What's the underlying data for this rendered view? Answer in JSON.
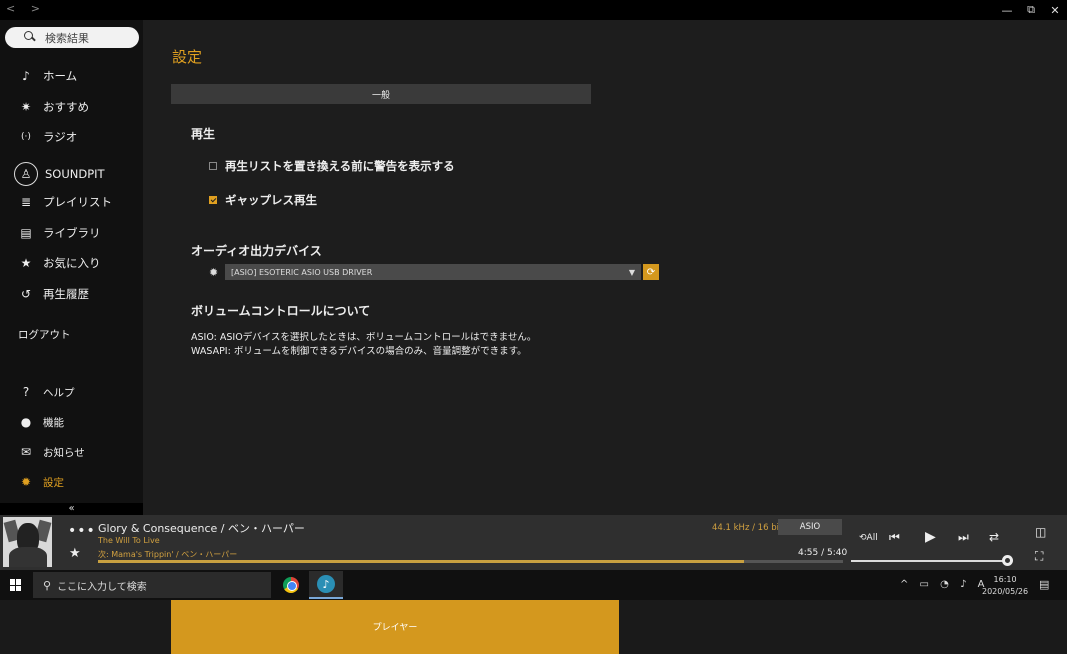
{
  "titlebar": {
    "back": "<",
    "forward": ">",
    "minimize": "—",
    "restore": "⧉",
    "close": "✕"
  },
  "sidebar": {
    "search_placeholder": "検索結果",
    "items": [
      {
        "label": "ホーム",
        "icon": "home-logo-icon",
        "glyph": "♪"
      },
      {
        "label": "おすすめ",
        "icon": "sparkle-icon",
        "glyph": "✷"
      },
      {
        "label": "ラジオ",
        "icon": "radio-icon",
        "glyph": "(·)"
      },
      {
        "label": "SOUNDPIT",
        "icon": "user-icon",
        "glyph": "♙"
      },
      {
        "label": "プレイリスト",
        "icon": "playlist-icon",
        "glyph": "≣"
      },
      {
        "label": "ライブラリ",
        "icon": "library-icon",
        "glyph": "▤"
      },
      {
        "label": "お気に入り",
        "icon": "star-icon",
        "glyph": "★"
      },
      {
        "label": "再生履歴",
        "icon": "history-icon",
        "glyph": "↺"
      }
    ],
    "logout": "ログアウト",
    "bottom_items": [
      {
        "label": "ヘルプ",
        "icon": "help-icon",
        "glyph": "?"
      },
      {
        "label": "機能",
        "icon": "new-badge-icon",
        "glyph": "●"
      },
      {
        "label": "お知らせ",
        "icon": "mail-icon",
        "glyph": "✉"
      },
      {
        "label": "設定",
        "icon": "gear-icon",
        "glyph": "✹"
      }
    ],
    "collapse": "«"
  },
  "main": {
    "title": "設定",
    "tabs": [
      {
        "label": "一般"
      },
      {
        "label": "プレイヤー"
      }
    ],
    "playback": {
      "title": "再生",
      "warn_replace_label": "再生リストを置き換える前に警告を表示する",
      "warn_replace_checked": false,
      "gapless_label": "ギャップレス再生",
      "gapless_checked": true
    },
    "audio_device": {
      "title": "オーディオ出力デバイス",
      "selected": "[ASIO] ESOTERIC ASIO USB DRIVER"
    },
    "volume": {
      "title": "ボリュームコントロールについて",
      "line1": "ASIO: ASIOデバイスを選択したときは、ボリュームコントロールはできません。",
      "line2": "WASAPI: ボリュームを制御できるデバイスの場合のみ、音量調整ができます。"
    }
  },
  "player": {
    "title": "Glory & Consequence / ベン・ハーパー",
    "album": "The Will To Live",
    "next": "次: Mama's Trippin' / ベン・ハーパー",
    "format": "44.1 kHz / 16 bit",
    "output": "ASIO",
    "time": "4:55 / 5:40",
    "progress": 0.867,
    "volume": 1.0,
    "more": "•••",
    "star": "★",
    "controls": {
      "repeat_all": "⟲All",
      "prev": "⏮",
      "play": "▶",
      "next": "⏭",
      "shuffle": "⇄"
    },
    "side_panel": "◫",
    "fullscreen": "⛶"
  },
  "taskbar": {
    "search_placeholder": "ここに入力して検索",
    "tray": "^ ▭ ◔ ♪ A",
    "time": "16:10",
    "date": "2020/05/26",
    "notification": "▤"
  }
}
